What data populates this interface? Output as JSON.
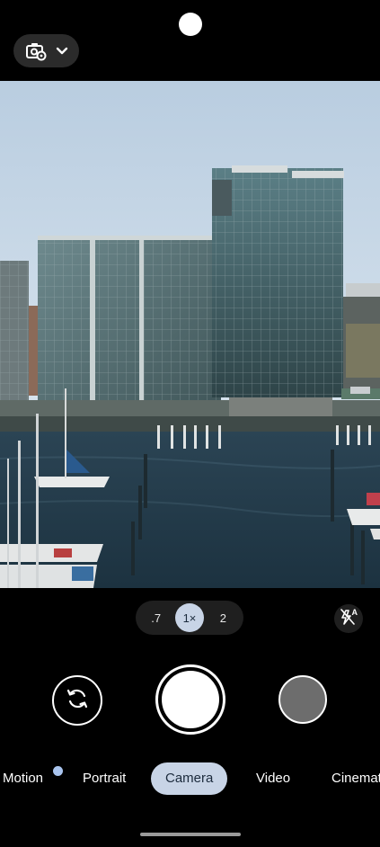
{
  "top_bar": {
    "settings_icon": "camera-settings-icon",
    "dropdown_icon": "chevron-down-icon"
  },
  "viewfinder": {
    "scene": "photo-preview-harbor-buildings"
  },
  "zoom": {
    "options": [
      ".7",
      "1×",
      "2"
    ],
    "selected": "1×"
  },
  "flash": {
    "icon": "flash-auto-off-icon"
  },
  "controls": {
    "flip_icon": "switch-camera-icon",
    "shutter_icon": "shutter-button",
    "thumbnail_icon": "last-photo-thumbnail"
  },
  "modes": {
    "items": [
      "Motion",
      "Portrait",
      "Camera",
      "Video",
      "Cinemat"
    ],
    "selected": "Camera"
  },
  "colors": {
    "accent": "#c8d4e6",
    "accent_text": "#1b2a3c",
    "dot": "#a9c4ee"
  }
}
